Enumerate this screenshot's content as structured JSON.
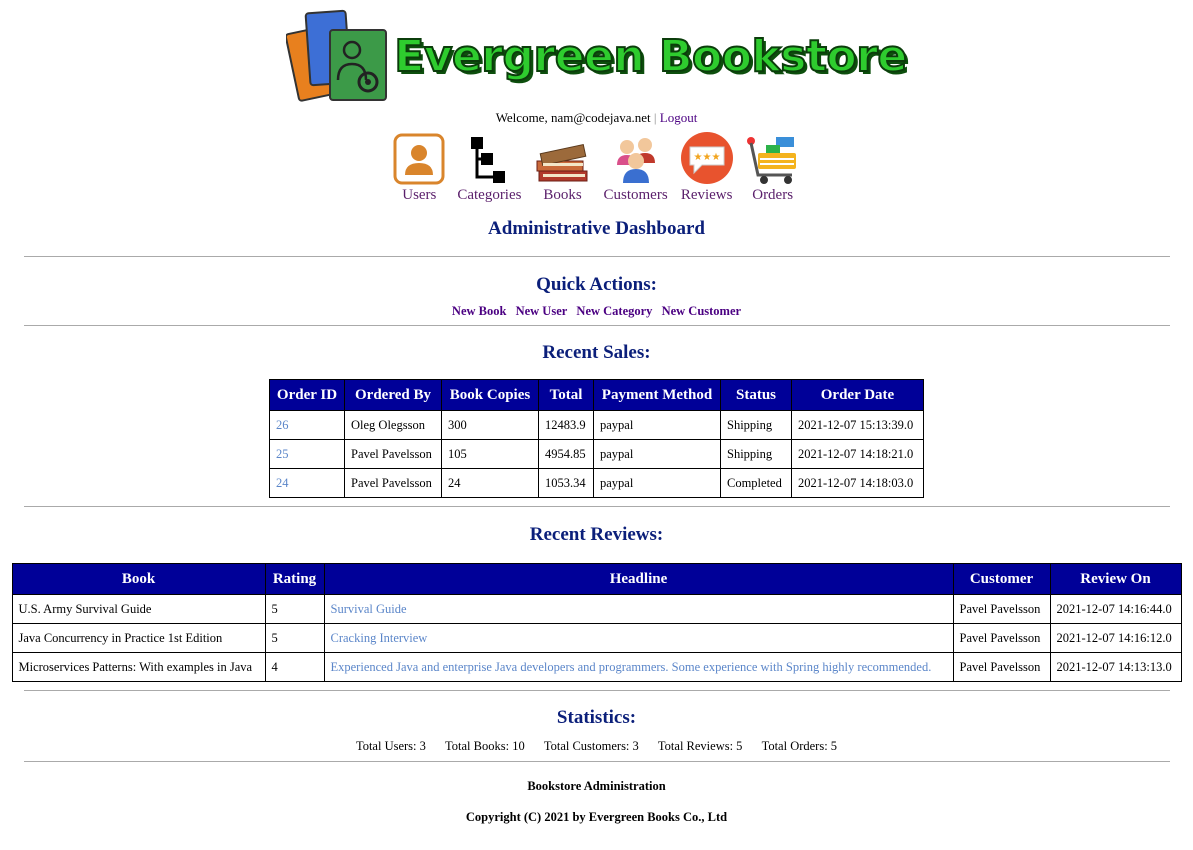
{
  "brand": {
    "title": "Evergreen Bookstore"
  },
  "header": {
    "welcome_prefix": "Welcome, nam@codejava.net",
    "separator": "|",
    "logout": "Logout"
  },
  "nav": {
    "items": [
      {
        "label": "Users"
      },
      {
        "label": "Categories"
      },
      {
        "label": "Books"
      },
      {
        "label": "Customers"
      },
      {
        "label": "Reviews"
      },
      {
        "label": "Orders"
      }
    ]
  },
  "dashboard_title": "Administrative Dashboard",
  "quick_actions": {
    "title": "Quick Actions:",
    "links": [
      "New Book",
      "New User",
      "New Category",
      "New Customer"
    ]
  },
  "recent_sales": {
    "title": "Recent Sales:",
    "columns": [
      "Order ID",
      "Ordered By",
      "Book Copies",
      "Total",
      "Payment Method",
      "Status",
      "Order Date"
    ],
    "rows": [
      [
        "26",
        "Oleg Olegsson",
        "300",
        "12483.9",
        "paypal",
        "Shipping",
        "2021-12-07 15:13:39.0"
      ],
      [
        "25",
        "Pavel Pavelsson",
        "105",
        "4954.85",
        "paypal",
        "Shipping",
        "2021-12-07 14:18:21.0"
      ],
      [
        "24",
        "Pavel Pavelsson",
        "24",
        "1053.34",
        "paypal",
        "Completed",
        "2021-12-07 14:18:03.0"
      ]
    ]
  },
  "recent_reviews": {
    "title": "Recent Reviews:",
    "columns": [
      "Book",
      "Rating",
      "Headline",
      "Customer",
      "Review On"
    ],
    "rows": [
      [
        "U.S. Army Survival Guide",
        "5",
        "Survival Guide",
        "Pavel Pavelsson",
        "2021-12-07 14:16:44.0"
      ],
      [
        "Java Concurrency in Practice 1st Edition",
        "5",
        "Cracking Interview",
        "Pavel Pavelsson",
        "2021-12-07 14:16:12.0"
      ],
      [
        "Microservices Patterns: With examples in Java",
        "4",
        "Experienced Java and enterprise Java developers and programmers. Some experience with Spring highly recommended.",
        "Pavel Pavelsson",
        "2021-12-07 14:13:13.0"
      ]
    ]
  },
  "statistics": {
    "title": "Statistics:",
    "items": [
      "Total Users: 3",
      "Total Books: 10",
      "Total Customers: 3",
      "Total Reviews: 5",
      "Total Orders: 5"
    ]
  },
  "footer": {
    "line1": "Bookstore Administration",
    "line2": "Copyright (C) 2021 by Evergreen Books Co., Ltd"
  },
  "colors": {
    "table_header_bg": "#000098",
    "heading": "#0b1f7a",
    "nav_label": "#5a1f6b",
    "link": "#5b86c9",
    "logo_green": "#2ecc2e"
  }
}
